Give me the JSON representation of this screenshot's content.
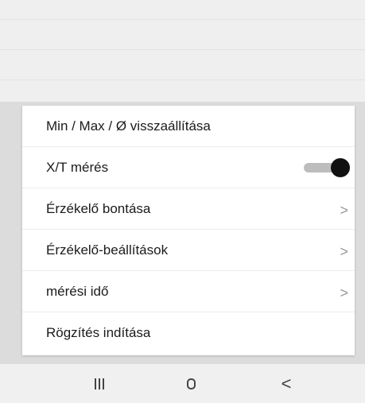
{
  "menu": {
    "items": [
      {
        "label": "Min / Max / Ø visszaállítása"
      },
      {
        "label": "X/T mérés",
        "toggle_on": true
      },
      {
        "label": "Érzékelő bontása",
        "chevron": ">"
      },
      {
        "label": "Érzékelő-beállítások",
        "chevron": ">"
      },
      {
        "label": "mérési idő",
        "chevron": ">"
      },
      {
        "label": "Rögzítés indítása"
      }
    ]
  },
  "navbar": {
    "icons": [
      "recents-icon",
      "home-icon",
      "back-icon"
    ],
    "back_glyph": "<"
  }
}
